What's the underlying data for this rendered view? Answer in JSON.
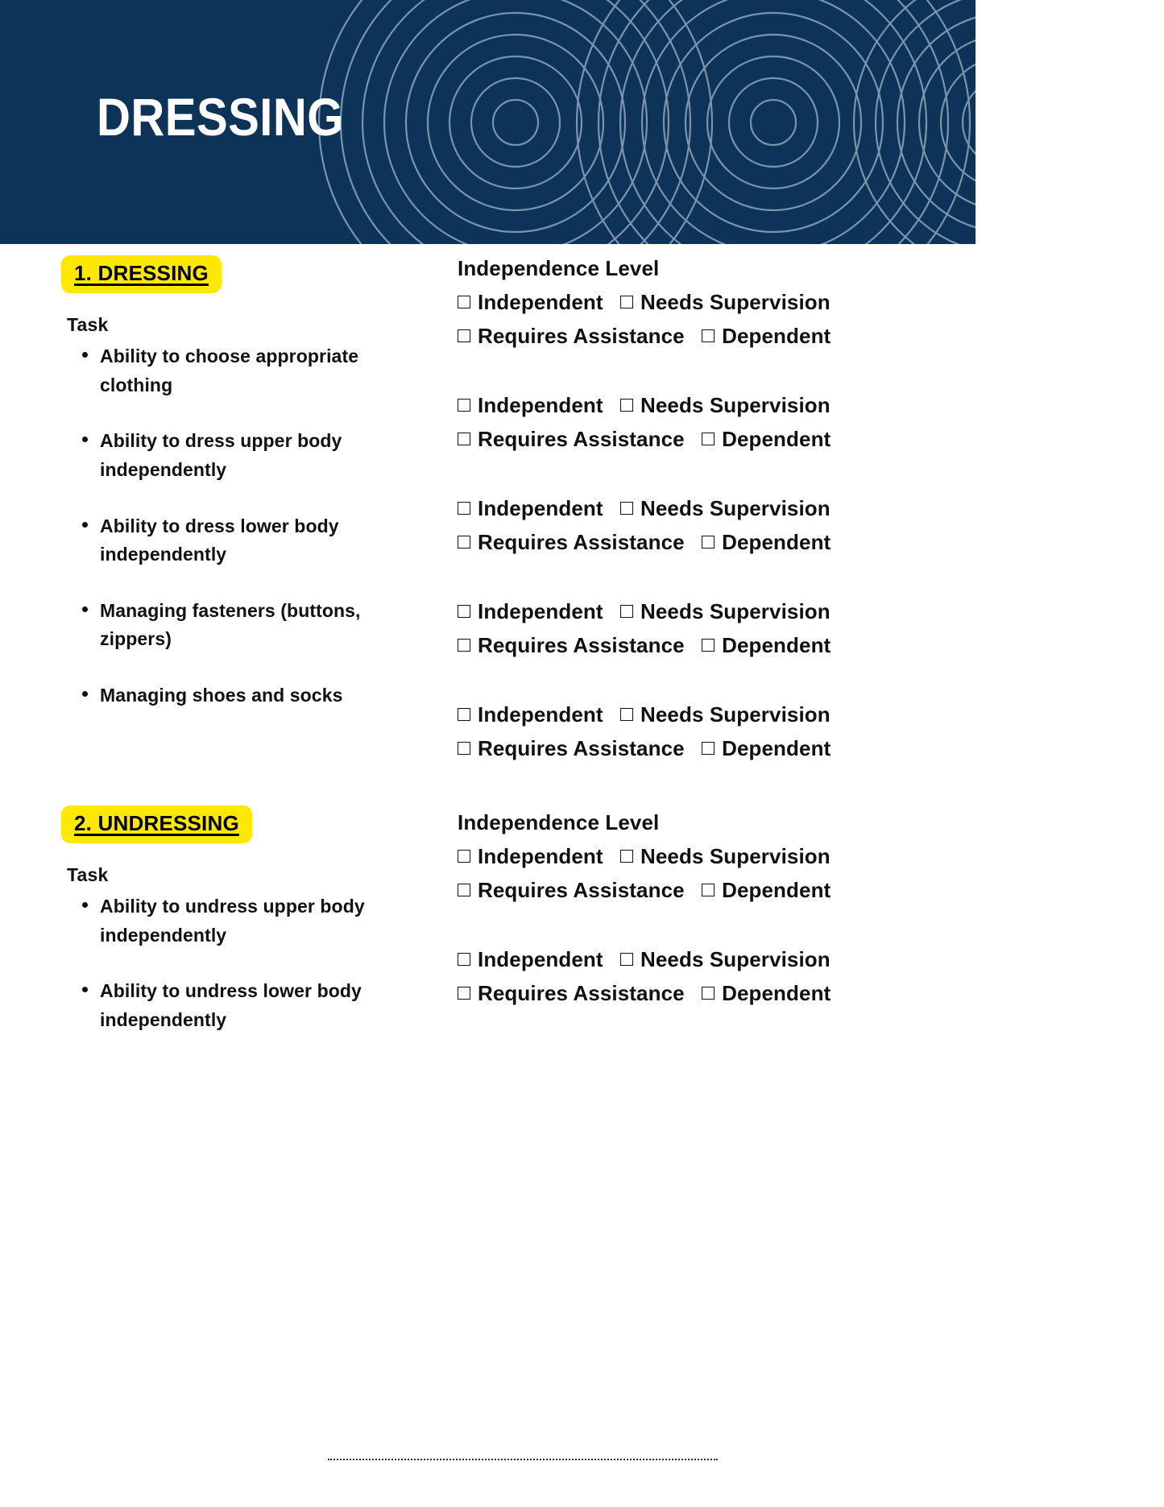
{
  "header": {
    "title": "DRESSING",
    "background_color": "#0d3359",
    "title_color": "#ffffff",
    "pattern_color": "#8fa6bd",
    "pattern_name": "concentric-circles"
  },
  "theme": {
    "highlight_color": "#ffe800",
    "text_color": "#111111",
    "page_background": "#ffffff"
  },
  "labels": {
    "task_heading": "Task",
    "independence_heading": "Independence Level",
    "checkbox_icon": "empty-checkbox"
  },
  "sections": [
    {
      "badge": "1. DRESSING",
      "task_heading": "Task",
      "independence_heading": "Independence Level",
      "tasks": [
        "Ability to choose appropriate clothing",
        "Ability to dress upper body independently",
        "Ability to dress lower body independently",
        "Managing fasteners (buttons, zippers)",
        "Managing shoes and socks"
      ],
      "option_groups": [
        [
          [
            "Independent",
            "Needs Supervision"
          ],
          [
            "Requires Assistance",
            "Dependent"
          ]
        ],
        [
          [
            "Independent",
            "Needs Supervision"
          ],
          [
            "Requires Assistance",
            "Dependent"
          ]
        ],
        [
          [
            "Independent",
            "Needs Supervision"
          ],
          [
            "Requires Assistance",
            "Dependent"
          ]
        ],
        [
          [
            "Independent",
            "Needs Supervision"
          ],
          [
            "Requires Assistance",
            "Dependent"
          ]
        ],
        [
          [
            "Independent",
            "Needs Supervision"
          ],
          [
            "Requires Assistance",
            "Dependent"
          ]
        ]
      ]
    },
    {
      "badge": "2. UNDRESSING",
      "task_heading": "Task",
      "independence_heading": "Independence Level",
      "tasks": [
        "Ability to undress upper body independently",
        "Ability to undress lower body independently"
      ],
      "option_groups": [
        [
          [
            "Independent",
            "Needs Supervision"
          ],
          [
            "Requires Assistance",
            "Dependent"
          ]
        ],
        [
          [
            "Independent",
            "Needs Supervision"
          ],
          [
            "Requires Assistance",
            "Dependent"
          ]
        ]
      ]
    }
  ]
}
